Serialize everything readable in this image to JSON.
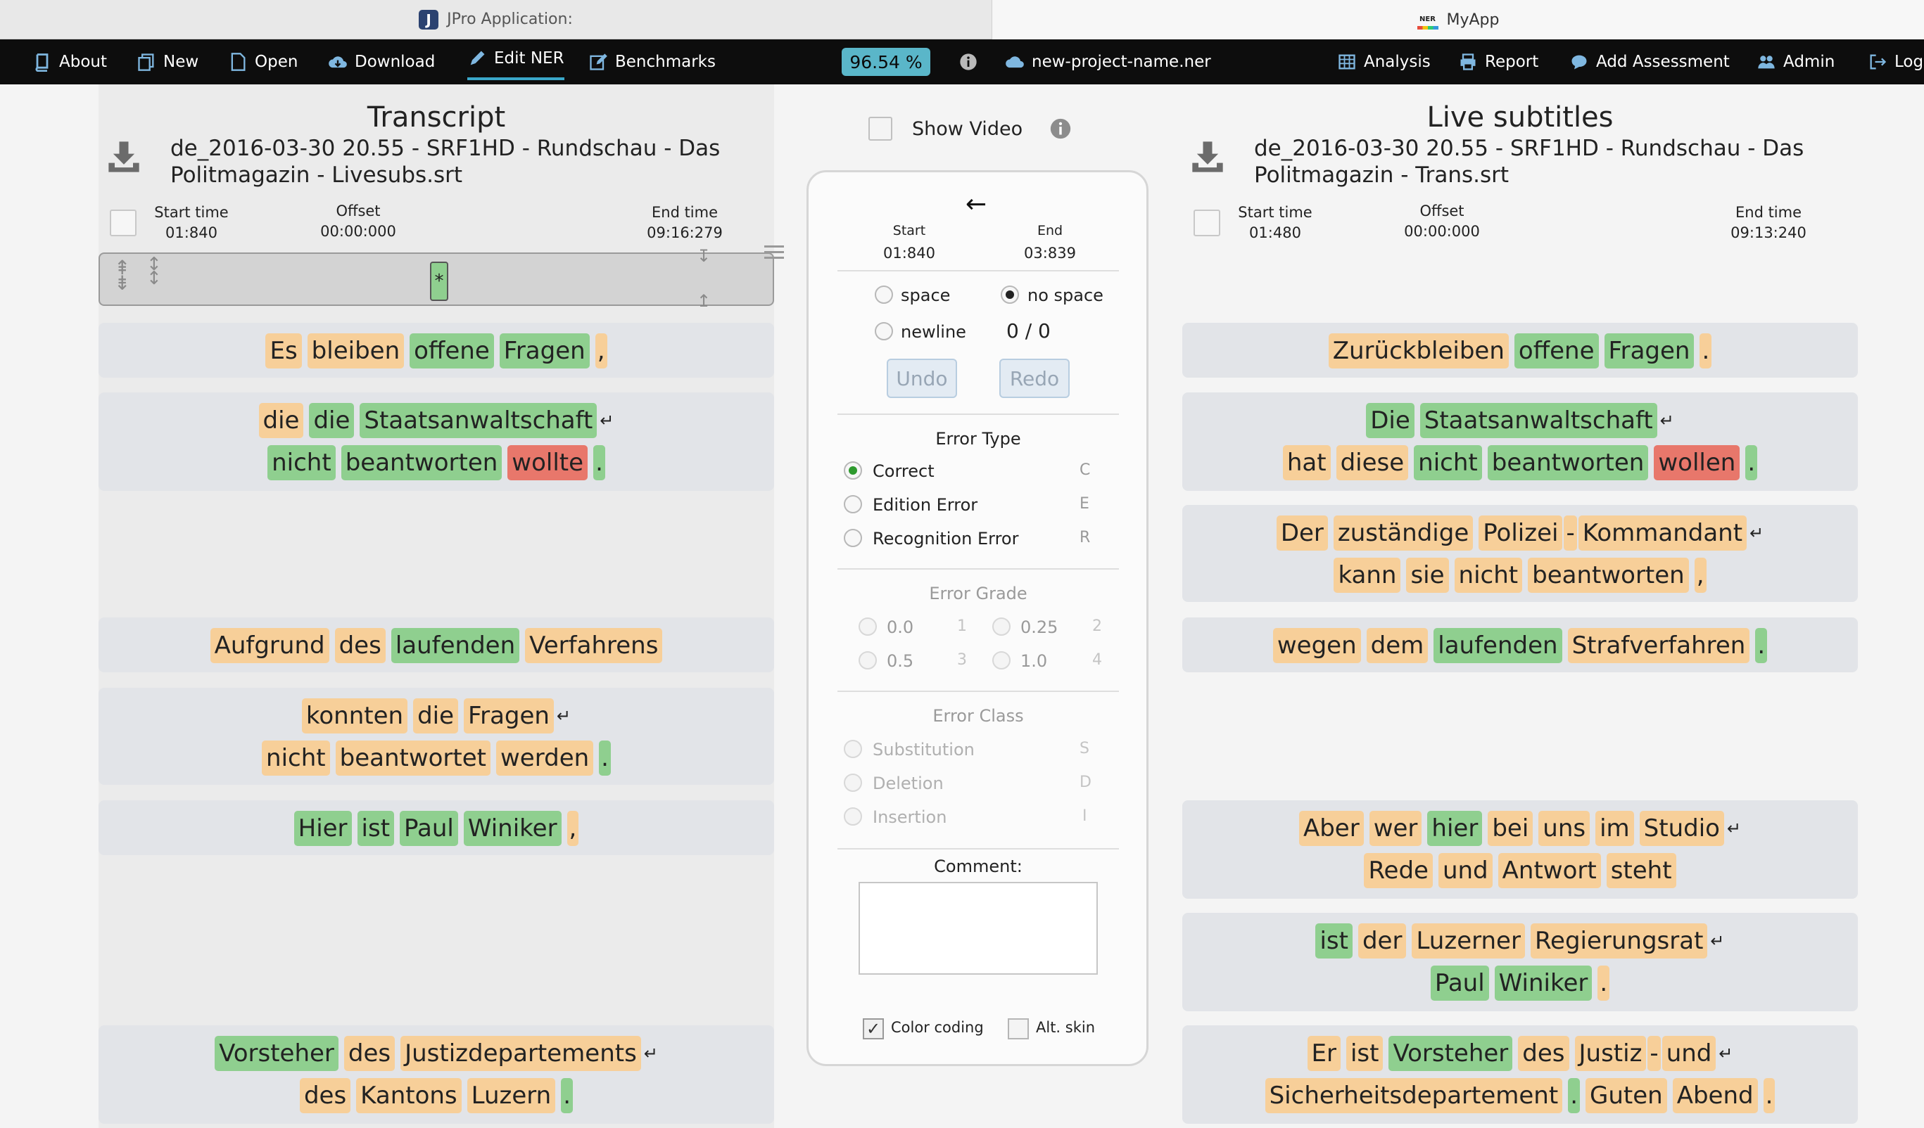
{
  "tabs": {
    "left_title": "JPro Application:",
    "right_title": "MyApp",
    "ner_favicon": "NER"
  },
  "nav": {
    "about": "About",
    "new": "New",
    "open": "Open",
    "download": "Download",
    "edit_ner": "Edit NER",
    "benchmarks": "Benchmarks",
    "score": "96.54 %",
    "project": "new-project-name.ner",
    "analysis": "Analysis",
    "report": "Report",
    "add_assessment": "Add Assessment",
    "admin": "Admin",
    "logout": "Log"
  },
  "left": {
    "title": "Transcript",
    "file_line1": "de_2016-03-30 20.55 - SRF1HD - Rundschau - Das",
    "file_line2": "Politmagazin - Livesubs.srt",
    "start_label": "Start time",
    "start": "01:840",
    "offset_label": "Offset",
    "offset": "00:00:000",
    "end_label": "End time",
    "end": "09:16:279",
    "marker": "*"
  },
  "right": {
    "title": "Live subtitles",
    "file_line1": "de_2016-03-30 20.55 - SRF1HD - Rundschau - Das",
    "file_line2": "Politmagazin - Trans.srt",
    "start_label": "Start time",
    "start": "01:480",
    "offset_label": "Offset",
    "offset": "00:00:000",
    "end_label": "End time",
    "end": "09:13:240"
  },
  "middle": {
    "show_video": "Show Video",
    "arrow": "←",
    "start_label": "Start",
    "start": "01:840",
    "end_label": "End",
    "end": "03:839",
    "space": "space",
    "no_space": "no space",
    "newline": "newline",
    "counter": "0 / 0",
    "undo": "Undo",
    "redo": "Redo",
    "error_type": "Error Type",
    "correct": "Correct",
    "correct_key": "C",
    "edition": "Edition Error",
    "edition_key": "E",
    "recognition": "Recognition Error",
    "recognition_key": "R",
    "error_grade": "Error Grade",
    "g0": "0.0",
    "g0k": "1",
    "g25": "0.25",
    "g25k": "2",
    "g5": "0.5",
    "g5k": "3",
    "g1": "1.0",
    "g1k": "4",
    "error_class": "Error Class",
    "substitution": "Substitution",
    "substitution_key": "S",
    "deletion": "Deletion",
    "deletion_key": "D",
    "insertion": "Insertion",
    "insertion_key": "I",
    "comment": "Comment:",
    "color_coding": "Color coding",
    "alt_skin": "Alt. skin"
  },
  "colors": {
    "correct": "#8fcf8f",
    "edition": "#f7cf99",
    "recognition": "#e8776b",
    "accent": "#5ab6c9"
  },
  "tokens": {
    "l1": [
      "Es",
      "bleiben",
      "offene",
      "Fragen",
      ","
    ],
    "l2a": [
      "die",
      "die",
      "Staatsanwaltschaft",
      "↵"
    ],
    "l2b": [
      "nicht",
      "beantworten",
      "wollte",
      "."
    ],
    "l3": [
      "Aufgrund",
      "des",
      "laufenden",
      "Verfahrens"
    ],
    "l4a": [
      "konnten",
      "die",
      "Fragen",
      "↵"
    ],
    "l4b": [
      "nicht",
      "beantwortet",
      "werden",
      "."
    ],
    "l5": [
      "Hier",
      "ist",
      "Paul",
      "Winiker",
      ","
    ],
    "l6a": [
      "Vorsteher",
      "des",
      "Justizdepartements",
      "↵"
    ],
    "l6b": [
      "des",
      "Kantons",
      "Luzern",
      "."
    ],
    "r1": [
      "Zurückbleiben",
      "offene",
      "Fragen",
      "."
    ],
    "r2a": [
      "Die",
      "Staatsanwaltschaft",
      "↵"
    ],
    "r2b": [
      "hat",
      "diese",
      "nicht",
      "beantworten",
      "wollen",
      "."
    ],
    "r3a": [
      "Der",
      "zuständige",
      "Polizei",
      "-",
      "Kommandant",
      "↵"
    ],
    "r3b": [
      "kann",
      "sie",
      "nicht",
      "beantworten",
      ","
    ],
    "r4": [
      "wegen",
      "dem",
      "laufenden",
      "Strafverfahren",
      "."
    ],
    "r5a": [
      "Aber",
      "wer",
      "hier",
      "bei",
      "uns",
      "im",
      "Studio",
      "↵"
    ],
    "r5b": [
      "Rede",
      "und",
      "Antwort",
      "steht"
    ],
    "r6a": [
      "ist",
      "der",
      "Luzerner",
      "Regierungsrat",
      "↵"
    ],
    "r6b": [
      "Paul",
      "Winiker",
      "."
    ],
    "r7a": [
      "Er",
      "ist",
      "Vorsteher",
      "des",
      "Justiz",
      "-",
      "und",
      "↵"
    ],
    "r7b": [
      "Sicherheitsdepartement",
      ".",
      "Guten",
      "Abend",
      "."
    ]
  }
}
